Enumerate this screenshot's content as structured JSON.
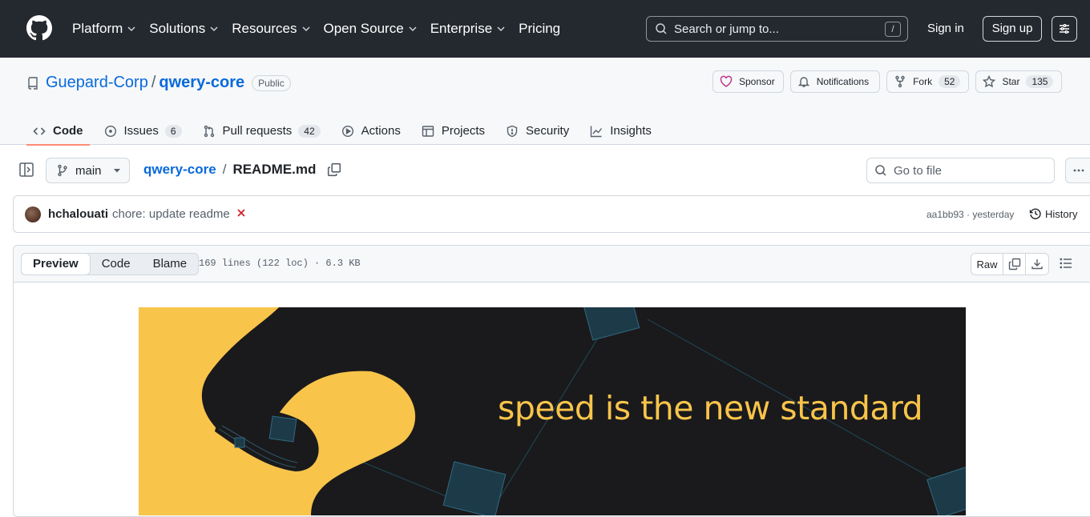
{
  "topnav": {
    "items": [
      {
        "label": "Platform",
        "has_menu": true
      },
      {
        "label": "Solutions",
        "has_menu": true
      },
      {
        "label": "Resources",
        "has_menu": true
      },
      {
        "label": "Open Source",
        "has_menu": true
      },
      {
        "label": "Enterprise",
        "has_menu": true
      },
      {
        "label": "Pricing",
        "has_menu": false
      }
    ],
    "search_placeholder": "Search or jump to...",
    "search_shortcut": "/",
    "signin_label": "Sign in",
    "signup_label": "Sign up"
  },
  "repo": {
    "owner": "Guepard-Corp",
    "name": "qwery-core",
    "visibility": "Public",
    "actions": {
      "sponsor_label": "Sponsor",
      "notifications_label": "Notifications",
      "fork_label": "Fork",
      "fork_count": "52",
      "star_label": "Star",
      "star_count": "135"
    },
    "tabs": [
      {
        "label": "Code",
        "icon": "code-icon",
        "active": true
      },
      {
        "label": "Issues",
        "icon": "issue-icon",
        "count": "6"
      },
      {
        "label": "Pull requests",
        "icon": "pull-request-icon",
        "count": "42"
      },
      {
        "label": "Actions",
        "icon": "play-icon"
      },
      {
        "label": "Projects",
        "icon": "table-icon"
      },
      {
        "label": "Security",
        "icon": "shield-icon"
      },
      {
        "label": "Insights",
        "icon": "graph-icon"
      }
    ]
  },
  "filenav": {
    "branch": "main",
    "crumb_repo": "qwery-core",
    "crumb_sep": "/",
    "file": "README.md",
    "goto_placeholder": "Go to file"
  },
  "commit": {
    "author": "hchalouati",
    "message": "chore: update readme",
    "status": "failed",
    "sha": "aa1bb93",
    "time": "yesterday",
    "sha_time": "aa1bb93 · yesterday",
    "history_label": "History"
  },
  "file": {
    "views": [
      "Preview",
      "Code",
      "Blame"
    ],
    "active_view": "Preview",
    "meta": "169 lines (122 loc) · 6.3 KB",
    "raw_label": "Raw"
  },
  "banner": {
    "tagline": "speed is the new standard",
    "colors": {
      "background": "#1a1a1c",
      "accent": "#f8c44a",
      "node": "#1d3a49"
    }
  },
  "colors": {
    "header_bg": "#24292f",
    "link": "#0969da",
    "active_tab": "#fd8c73",
    "error": "#cf222e"
  }
}
